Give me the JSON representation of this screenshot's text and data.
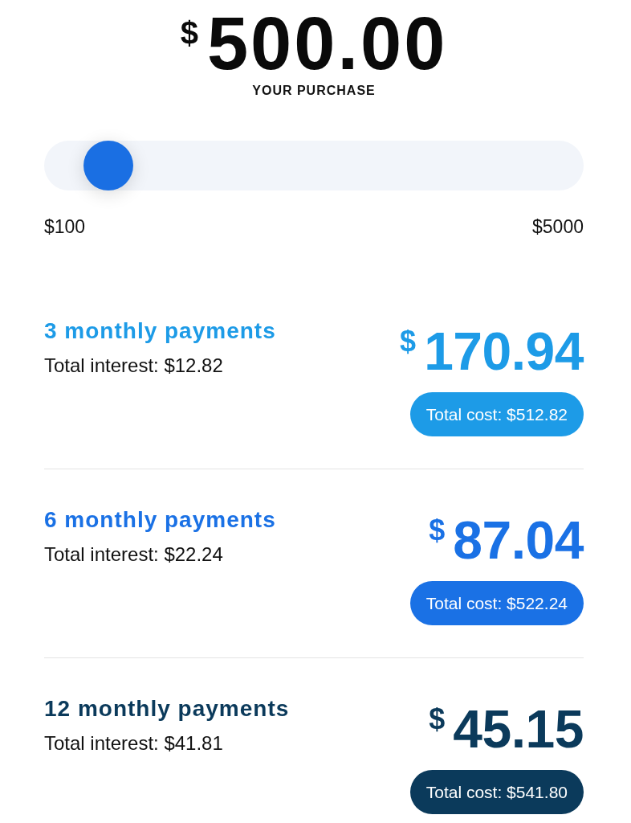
{
  "purchase": {
    "currency": "$",
    "amount": "500.00",
    "caption": "YOUR PURCHASE"
  },
  "slider": {
    "level": 0.08,
    "min_label": "$100",
    "max_label": "$5000"
  },
  "plans": [
    {
      "title": "3 monthly payments",
      "interest": "Total interest: $12.82",
      "currency": "$",
      "amount": "170.94",
      "total_cost": "Total cost: $512.82",
      "color": "#1d9be7"
    },
    {
      "title": "6 monthly payments",
      "interest": "Total interest: $22.24",
      "currency": "$",
      "amount": "87.04",
      "total_cost": "Total cost: $522.24",
      "color": "#1a71e5"
    },
    {
      "title": "12 monthly payments",
      "interest": "Total interest: $41.81",
      "currency": "$",
      "amount": "45.15",
      "total_cost": "Total cost: $541.80",
      "color": "#0b3a5b"
    }
  ]
}
